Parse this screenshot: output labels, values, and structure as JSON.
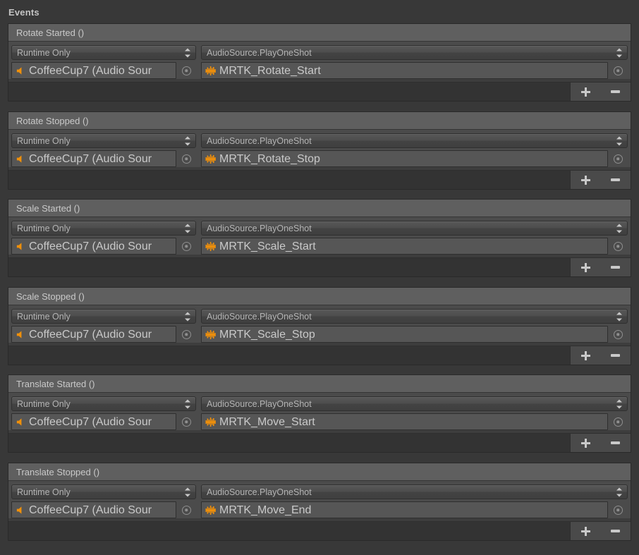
{
  "panel": {
    "section_title": "Events",
    "accent_orange": "#f0900a",
    "background": "#383838",
    "header_strip": "#5f5f5f"
  },
  "common": {
    "callback_mode": "Runtime Only",
    "function_label": "AudioSource.PlayOneShot",
    "target_object": "CoffeeCup7 (Audio Sour",
    "speaker_icon": "audio-source-icon",
    "waveform_icon": "audio-clip-icon",
    "picker_icon": "object-picker-icon",
    "dropdown_icon": "updown-arrows-icon",
    "add_label": "+",
    "remove_label": "−"
  },
  "events": [
    {
      "title": "Rotate Started ()",
      "mode": "Runtime Only",
      "target": "CoffeeCup7 (Audio Sour",
      "function": "AudioSource.PlayOneShot",
      "argument": "MRTK_Rotate_Start"
    },
    {
      "title": "Rotate Stopped ()",
      "mode": "Runtime Only",
      "target": "CoffeeCup7 (Audio Sour",
      "function": "AudioSource.PlayOneShot",
      "argument": "MRTK_Rotate_Stop"
    },
    {
      "title": "Scale Started ()",
      "mode": "Runtime Only",
      "target": "CoffeeCup7 (Audio Sour",
      "function": "AudioSource.PlayOneShot",
      "argument": "MRTK_Scale_Start"
    },
    {
      "title": "Scale Stopped ()",
      "mode": "Runtime Only",
      "target": "CoffeeCup7 (Audio Sour",
      "function": "AudioSource.PlayOneShot",
      "argument": "MRTK_Scale_Stop"
    },
    {
      "title": "Translate Started ()",
      "mode": "Runtime Only",
      "target": "CoffeeCup7 (Audio Sour",
      "function": "AudioSource.PlayOneShot",
      "argument": "MRTK_Move_Start"
    },
    {
      "title": "Translate Stopped ()",
      "mode": "Runtime Only",
      "target": "CoffeeCup7 (Audio Sour",
      "function": "AudioSource.PlayOneShot",
      "argument": "MRTK_Move_End"
    }
  ]
}
